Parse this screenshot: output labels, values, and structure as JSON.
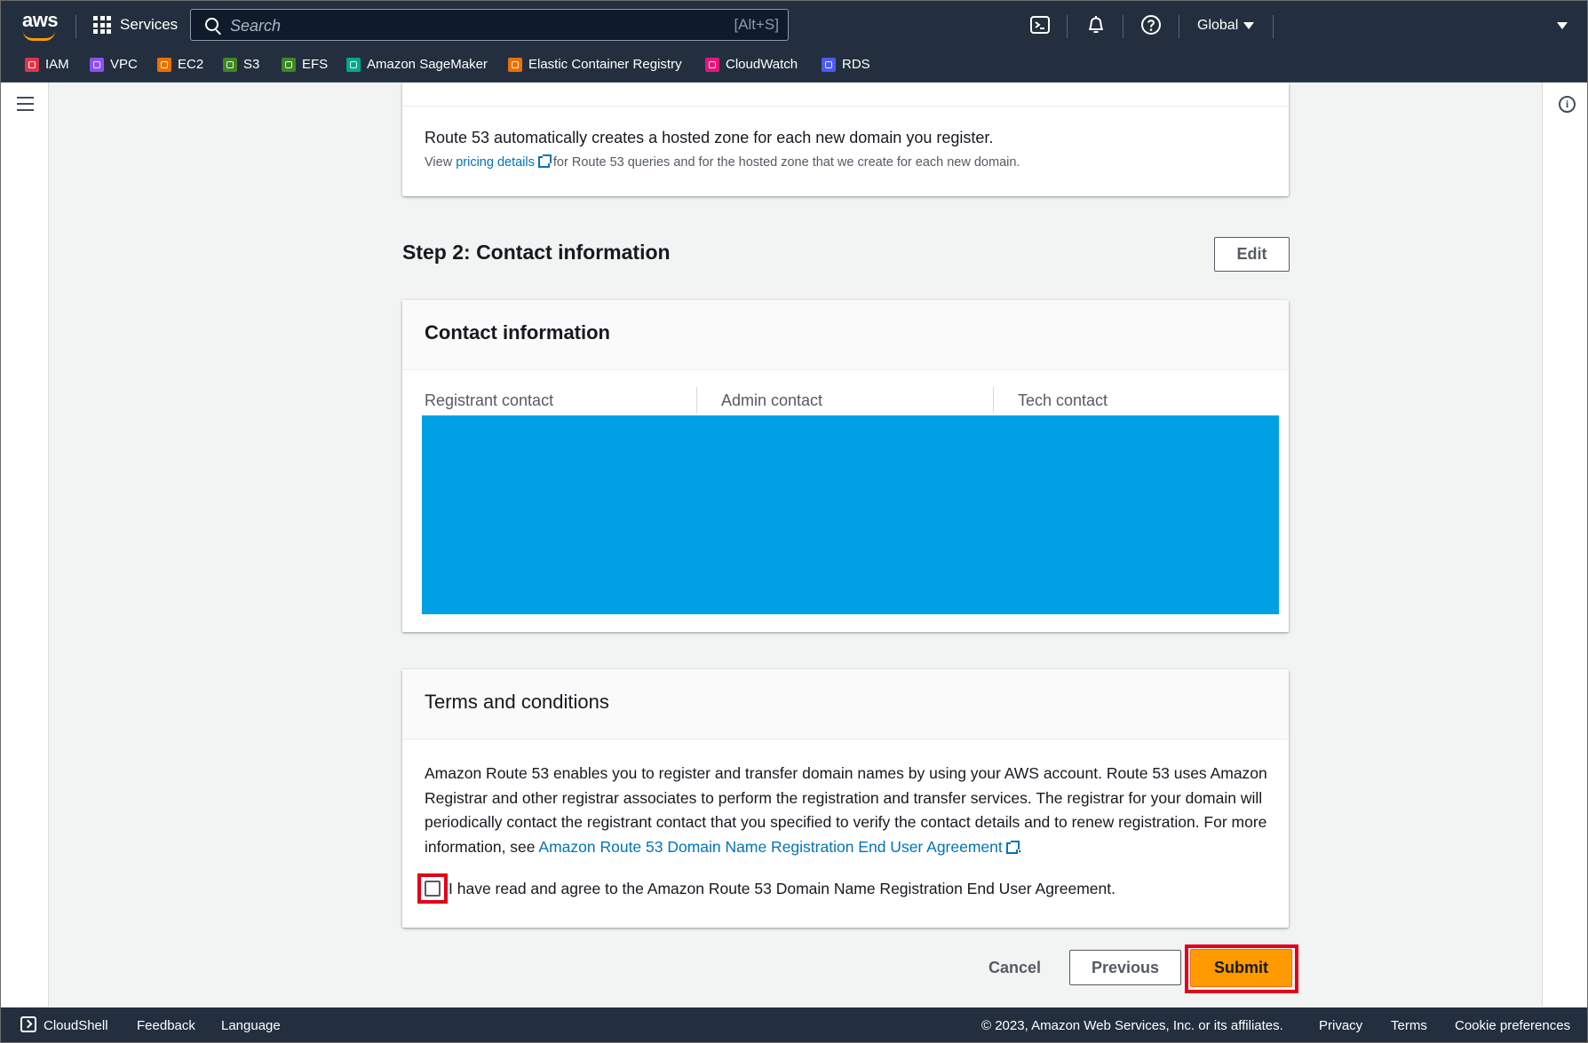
{
  "topnav": {
    "logo_text": "aws",
    "services_label": "Services",
    "search_placeholder": "Search",
    "search_shortcut": "[Alt+S]",
    "region_label": "Global"
  },
  "favorites": [
    {
      "label": "IAM",
      "color": "#dd344c"
    },
    {
      "label": "VPC",
      "color": "#8c4fff"
    },
    {
      "label": "EC2",
      "color": "#ed7100"
    },
    {
      "label": "S3",
      "color": "#3f8624"
    },
    {
      "label": "EFS",
      "color": "#3f8624"
    },
    {
      "label": "Amazon SageMaker",
      "color": "#01a88d"
    },
    {
      "label": "Elastic Container Registry",
      "color": "#ed7100"
    },
    {
      "label": "CloudWatch",
      "color": "#e7157b"
    },
    {
      "label": "RDS",
      "color": "#4b5aff"
    }
  ],
  "hosted_zone": {
    "line1": "Route 53 automatically creates a hosted zone for each new domain you register.",
    "line2_prefix": "View ",
    "line2_link": "pricing details",
    "line2_suffix": " for Route 53 queries and for the hosted zone that we create for each new domain."
  },
  "step2": {
    "heading": "Step 2: Contact information",
    "edit_label": "Edit",
    "panel_title": "Contact information",
    "columns": [
      "Registrant contact",
      "Admin contact",
      "Tech contact"
    ]
  },
  "terms": {
    "title": "Terms and conditions",
    "para_text": "Amazon Route 53 enables you to register and transfer domain names by using your AWS account. Route 53 uses Amazon Registrar and other registrar associates to perform the registration and transfer services. The registrar for your domain will periodically contact the registrant contact that you specified to verify the contact details and to renew registration. For more information, see ",
    "para_link": "Amazon Route 53 Domain Name Registration End User Agreement",
    "para_end": ".",
    "agree_label": "I have read and agree to the Amazon Route 53 Domain Name Registration End User Agreement."
  },
  "actions": {
    "cancel": "Cancel",
    "previous": "Previous",
    "submit": "Submit"
  },
  "footer": {
    "cloudshell": "CloudShell",
    "feedback": "Feedback",
    "language": "Language",
    "copyright": "© 2023, Amazon Web Services, Inc. or its affiliates.",
    "privacy": "Privacy",
    "terms": "Terms",
    "cookies": "Cookie preferences"
  },
  "colors": {
    "nav_bg": "#232f3e",
    "link": "#0073bb",
    "primary_button": "#ff9900",
    "highlight": "#e2001a",
    "redaction": "#00a1e4"
  }
}
